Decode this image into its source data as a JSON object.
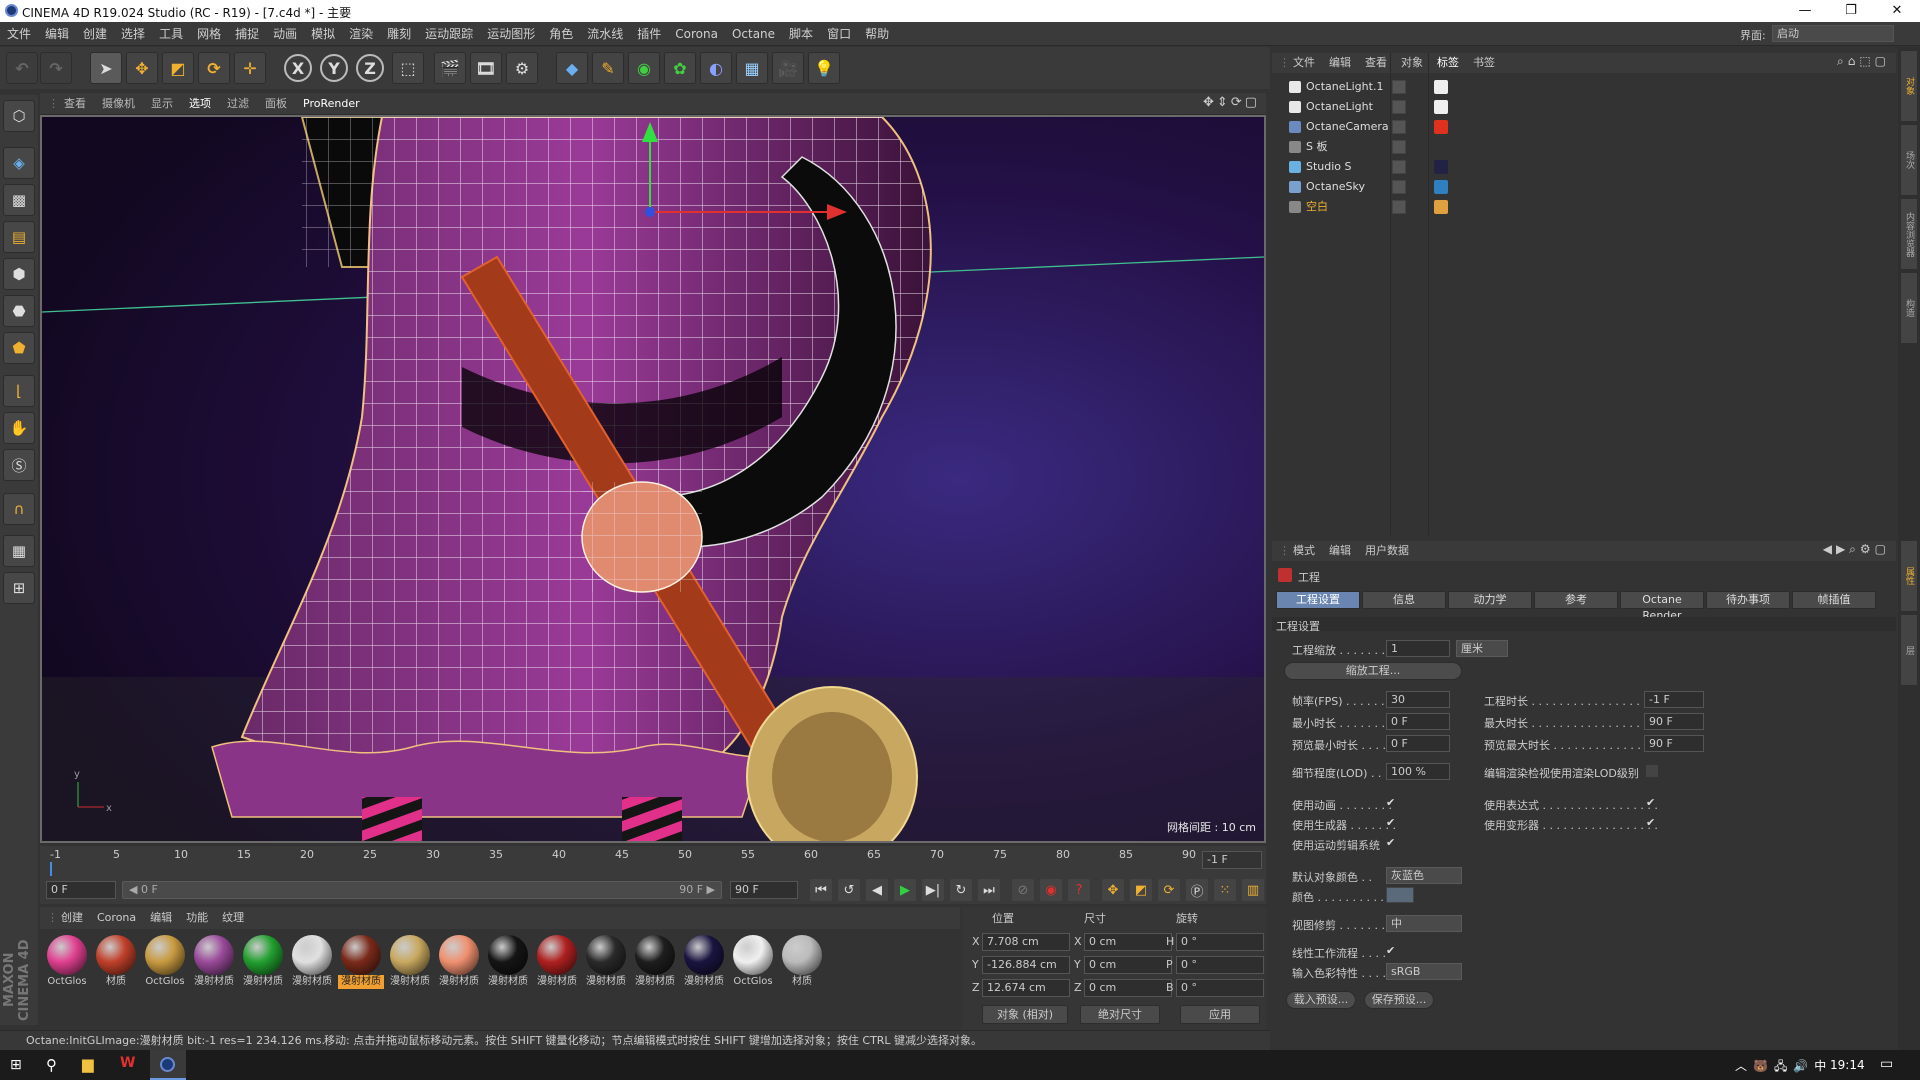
{
  "title_bar": {
    "title": "CINEMA 4D R19.024 Studio (RC - R19) - [7.c4d *] - 主要",
    "minimize": "—",
    "maximize": "❐",
    "close": "✕"
  },
  "menu": [
    "文件",
    "编辑",
    "创建",
    "选择",
    "工具",
    "网格",
    "捕捉",
    "动画",
    "模拟",
    "渲染",
    "雕刻",
    "运动跟踪",
    "运动图形",
    "角色",
    "流水线",
    "插件",
    "Corona",
    "Octane",
    "脚本",
    "窗口",
    "帮助"
  ],
  "layout": {
    "label": "界面:",
    "value": "启动"
  },
  "toolbar": {
    "x": "X",
    "y": "Y",
    "z": "Z"
  },
  "viewport": {
    "menu": [
      "查看",
      "摄像机",
      "显示",
      "选项",
      "过滤",
      "面板",
      "ProRender"
    ],
    "grid_label": "网格间距 : 10 cm",
    "axis_y": "y",
    "axis_x": "x"
  },
  "timeline": {
    "ticks": [
      "-1",
      "5",
      "10",
      "15",
      "20",
      "25",
      "30",
      "35",
      "40",
      "45",
      "50",
      "55",
      "60",
      "65",
      "70",
      "75",
      "80",
      "85",
      "90"
    ],
    "current": "-1 F"
  },
  "playback": {
    "start": "0 F",
    "range_start": "◀ 0 F",
    "range_end": "90 F ▶",
    "end": "90 F"
  },
  "materials": {
    "menu": [
      "创建",
      "Corona",
      "编辑",
      "功能",
      "纹理"
    ],
    "items": [
      {
        "label": "OctGlos",
        "color": "#e04090",
        "selected": false
      },
      {
        "label": "材质",
        "color": "#c0402a",
        "selected": false
      },
      {
        "label": "OctGlos",
        "color": "#c89a40",
        "selected": false
      },
      {
        "label": "漫射材质",
        "color": "#9a4a9a",
        "selected": false
      },
      {
        "label": "漫射材质",
        "color": "#22a030",
        "selected": false
      },
      {
        "label": "漫射材质",
        "color": "#e0e0e0",
        "selected": false
      },
      {
        "label": "漫射材质",
        "color": "#7a2a1a",
        "selected": true
      },
      {
        "label": "漫射材质",
        "color": "#c8a860",
        "selected": false
      },
      {
        "label": "漫射材质",
        "color": "#f09070",
        "selected": false
      },
      {
        "label": "漫射材质",
        "color": "#151515",
        "selected": false
      },
      {
        "label": "漫射材质",
        "color": "#b02020",
        "selected": false
      },
      {
        "label": "漫射材质",
        "color": "#2a2a2a",
        "selected": false
      },
      {
        "label": "漫射材质",
        "color": "#1e1e1e",
        "selected": false
      },
      {
        "label": "漫射材质",
        "color": "#1a1440",
        "selected": false
      },
      {
        "label": "OctGlos",
        "color": "#f0f0f0",
        "selected": false
      },
      {
        "label": "材质",
        "color": "#bbbbbb",
        "selected": false
      }
    ]
  },
  "coords": {
    "headers": {
      "position": "位置",
      "size": "尺寸",
      "rotation": "旋转"
    },
    "rows": [
      {
        "axis": "X",
        "pos": "7.708 cm",
        "saxis": "X",
        "size": "0 cm",
        "raxis": "H",
        "rot": "0 °"
      },
      {
        "axis": "Y",
        "pos": "-126.884 cm",
        "saxis": "Y",
        "size": "0 cm",
        "raxis": "P",
        "rot": "0 °"
      },
      {
        "axis": "Z",
        "pos": "12.674 cm",
        "saxis": "Z",
        "size": "0 cm",
        "raxis": "B",
        "rot": "0 °"
      }
    ],
    "mode": "对象 (相对)",
    "size_mode": "绝对尺寸",
    "apply": "应用"
  },
  "status": {
    "left": "Octane:InitGLImage:漫射材质  bit:-1 res=1  234.126 ms.",
    "right": "移动: 点击并拖动鼠标移动元素。按住 SHIFT 键量化移动；节点编辑模式时按住 SHIFT 键增加选择对象；按住 CTRL 键减少选择对象。"
  },
  "objects": {
    "menu": [
      "文件",
      "编辑",
      "查看",
      "对象",
      "标签",
      "书签"
    ],
    "items": [
      {
        "name": "OctaneLight.1",
        "icon_color": "#e8e8e8",
        "tag": "#f0f0f0",
        "highlight": false
      },
      {
        "name": "OctaneLight",
        "icon_color": "#e8e8e8",
        "tag": "#f0f0f0",
        "highlight": false
      },
      {
        "name": "OctaneCamera",
        "icon_color": "#6a8ac0",
        "tag": "#e03020",
        "highlight": false
      },
      {
        "name": "S 板",
        "icon_color": "#888888",
        "tag": "",
        "highlight": false
      },
      {
        "name": "Studio S",
        "icon_color": "#6ab0e0",
        "tag": "#222244",
        "highlight": false
      },
      {
        "name": "OctaneSky",
        "icon_color": "#7aa0d0",
        "tag": "#3080c0",
        "highlight": false
      },
      {
        "name": "空白",
        "icon_color": "#888888",
        "tag": "#e0a040",
        "highlight": true
      }
    ]
  },
  "attributes": {
    "menu": [
      "模式",
      "编辑",
      "用户数据"
    ],
    "header": "工程",
    "tabs": [
      "工程设置",
      "信息",
      "动力学",
      "参考",
      "Octane Render",
      "待办事项",
      "帧插值"
    ],
    "section": "工程设置",
    "scale_label": "工程缩放 . . . . . . . .",
    "scale_value": "1",
    "scale_unit": "厘米",
    "scale_btn": "缩放工程...",
    "fps_label": "帧率(FPS) . . . . . . .",
    "fps_value": "30",
    "duration_label": "工程时长 . . . . . . . . . . . . . . . . . .",
    "duration_value": "-1 F",
    "min_label": "最小时长 . . . . . . . . .",
    "min_value": "0 F",
    "max_label": "最大时长 . . . . . . . . . . . . . . . . . .",
    "max_value": "90 F",
    "pmin_label": "预览最小时长 . . . .",
    "pmin_value": "0 F",
    "pmax_label": "预览最大时长 . . . . . . . . . . . . .",
    "pmax_value": "90 F",
    "lod_label": "细节程度(LOD) . . .",
    "lod_value": "100 %",
    "lod_edit_label": "编辑渲染检视使用渲染LOD级别",
    "anim_label": "使用动画 . . . . . . . .",
    "expr_label": "使用表达式 . . . . . . . . . . . . . . . . .",
    "gen_label": "使用生成器 . . . . . . .",
    "deform_label": "使用变形器 . . . . . . . . . . . . . . . . .",
    "motion_label": "使用运动剪辑系统",
    "defcolor_label": "默认对象颜色 . .",
    "defcolor_value": "灰蓝色",
    "color_label": "颜色 . . . . . . . . . . .",
    "clip_label": "视图修剪 . . . . . . . .",
    "clip_value": "中",
    "linear_label": "线性工作流程 . . . .",
    "inputcolor_label": "输入色彩特性 . . . .",
    "inputcolor_value": "sRGB",
    "load_btn": "载入预设...",
    "save_btn": "保存预设..."
  },
  "right_strip": [
    "对象",
    "场次",
    "内容浏览器",
    "构造",
    "属性",
    "层"
  ],
  "taskbar": {
    "time": "19:14"
  }
}
